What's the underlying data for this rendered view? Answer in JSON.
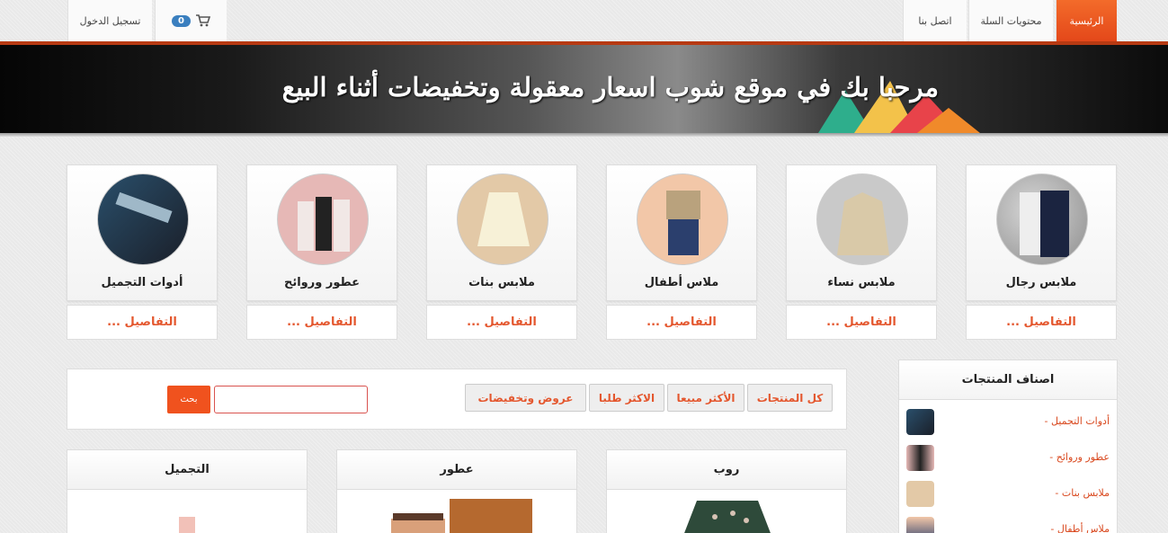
{
  "nav": {
    "home": "الرئيسية",
    "cart_contents": "محتويات السلة",
    "contact": "اتصل بنا",
    "login": "تسجيل الدخول",
    "cart_count": "0"
  },
  "banner": {
    "title": "مرحبا بك في موقع شوب اسعار معقولة وتخفيضات أثناء البيع"
  },
  "categories": [
    {
      "name": "ملابس رجال",
      "details": "... التفاصيل"
    },
    {
      "name": "ملابس نساء",
      "details": "... التفاصيل"
    },
    {
      "name": "ملاس أطفال",
      "details": "... التفاصيل"
    },
    {
      "name": "ملابس بنات",
      "details": "... التفاصيل"
    },
    {
      "name": "عطور وروائح",
      "details": "... التفاصيل"
    },
    {
      "name": "أدوات التجميل",
      "details": "... التفاصيل"
    }
  ],
  "filters": {
    "all": "كل المنتجات",
    "best_selling": "الأكثر مبيعا",
    "most_requested": "الاكثر طلبا",
    "offers": "عروض وتخفيضات",
    "search_button": "بحث",
    "search_value": ""
  },
  "sidebar": {
    "title": "اصناف المنتجات",
    "items": [
      {
        "label": "- أدوات التجميل"
      },
      {
        "label": "- عطور وروائح"
      },
      {
        "label": "- ملابس بنات"
      },
      {
        "label": "- ملاس أطفال"
      }
    ]
  },
  "panels": [
    {
      "title": "روب"
    },
    {
      "title": "عطور"
    },
    {
      "title": "التجميل"
    }
  ],
  "colors": {
    "accent": "#f0521e",
    "link": "#e4572e",
    "badge": "#3a7fbf"
  }
}
